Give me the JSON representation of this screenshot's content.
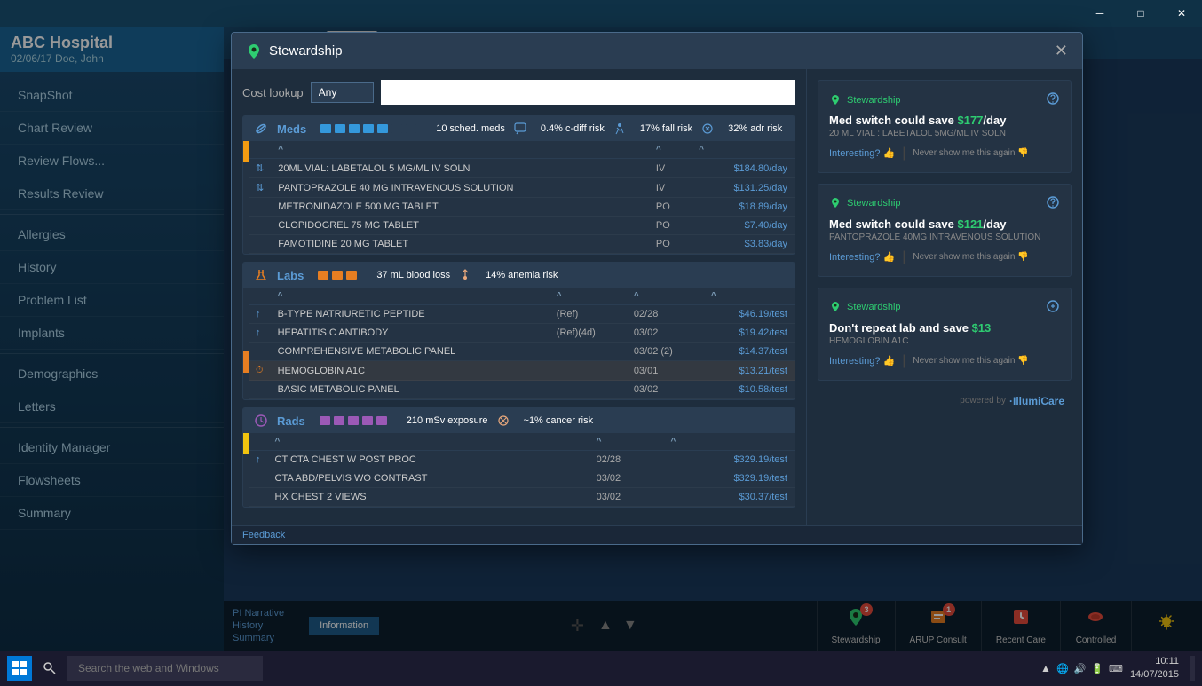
{
  "window": {
    "title": "Stewardship",
    "close_label": "✕",
    "minimize_label": "─",
    "maximize_label": "□"
  },
  "top_bar": {},
  "sidebar": {
    "hospital": "ABC Hospital",
    "date_patient": "02/06/17  Doe, John",
    "items": [
      {
        "label": "SnapShot",
        "active": false
      },
      {
        "label": "Chart Review",
        "active": false
      },
      {
        "label": "Review Flows...",
        "active": false
      },
      {
        "label": "Results Review",
        "active": false
      },
      {
        "label": "Allergies",
        "active": false
      },
      {
        "label": "History",
        "active": false
      },
      {
        "label": "Problem List",
        "active": false
      },
      {
        "label": "Implants",
        "active": false
      },
      {
        "label": "Demographics",
        "active": false
      },
      {
        "label": "Letters",
        "active": false
      },
      {
        "label": "Identity Manager",
        "active": false
      },
      {
        "label": "Flowsheets",
        "active": false
      },
      {
        "label": "Summary",
        "active": false
      }
    ]
  },
  "modal": {
    "title": "Stewardship",
    "cost_lookup_label": "Cost lookup",
    "cost_lookup_select": "Any",
    "cost_lookup_placeholder": "",
    "sections": {
      "meds": {
        "title": "Meds",
        "bar_count": 7,
        "stat1": "10 sched. meds",
        "stat2": "0.4% c-diff risk",
        "stat3": "17% fall risk",
        "stat4": "32% adr risk",
        "rows": [
          {
            "icon": "↑",
            "name": "20ML VIAL: LABETALOL 5 MG/ML IV SOLN",
            "route": "IV",
            "price": "$184.80/day",
            "indicator": "yellow"
          },
          {
            "icon": "↑",
            "name": "PANTOPRAZOLE 40 MG INTRAVENOUS SOLUTION",
            "route": "IV",
            "price": "$131.25/day",
            "indicator": "none"
          },
          {
            "icon": "",
            "name": "METRONIDAZOLE 500 MG TABLET",
            "route": "PO",
            "price": "$18.89/day",
            "indicator": "none"
          },
          {
            "icon": "",
            "name": "CLOPIDOGREL 75 MG TABLET",
            "route": "PO",
            "price": "$7.40/day",
            "indicator": "none"
          },
          {
            "icon": "",
            "name": "FAMOTIDINE 20 MG TABLET",
            "route": "PO",
            "price": "$3.83/day",
            "indicator": "none"
          }
        ]
      },
      "labs": {
        "title": "Labs",
        "bar_count": 3,
        "stat1": "37 mL blood loss",
        "stat2": "14% anemia risk",
        "rows": [
          {
            "icon": "↑",
            "name": "B-TYPE NATRIURETIC PEPTIDE",
            "ref": "(Ref)",
            "date": "02/28",
            "price": "$46.19/test",
            "indicator": "none"
          },
          {
            "icon": "↑",
            "name": "HEPATITIS C ANTIBODY",
            "ref": "(Ref)(4d)",
            "date": "03/02",
            "price": "$19.42/test",
            "indicator": "none"
          },
          {
            "icon": "",
            "name": "COMPREHENSIVE METABOLIC PANEL",
            "ref": "",
            "date": "03/02 (2)",
            "price": "$14.37/test",
            "indicator": "none"
          },
          {
            "icon": "⏱",
            "name": "HEMOGLOBIN A1C",
            "ref": "",
            "date": "03/01",
            "price": "$13.21/test",
            "indicator": "orange"
          },
          {
            "icon": "",
            "name": "BASIC METABOLIC PANEL",
            "ref": "",
            "date": "03/02",
            "price": "$10.58/test",
            "indicator": "none"
          }
        ]
      },
      "rads": {
        "title": "Rads",
        "bar_count": 5,
        "stat1": "210 mSv exposure",
        "stat2": "~1% cancer risk",
        "rows": [
          {
            "icon": "↑",
            "name": "CT CTA CHEST W POST PROC",
            "date": "02/28",
            "price": "$329.19/test",
            "indicator": "yellow"
          },
          {
            "icon": "",
            "name": "CTA ABD/PELVIS WO CONTRAST",
            "date": "03/02",
            "price": "$329.19/test",
            "indicator": "none"
          },
          {
            "icon": "",
            "name": "HX CHEST 2 VIEWS",
            "date": "03/02",
            "price": "$30.37/test",
            "indicator": "none"
          }
        ]
      }
    },
    "suggestions": [
      {
        "brand": "Stewardship",
        "title_prefix": "Med switch could save ",
        "amount": "$177",
        "title_suffix": "/day",
        "detail": "20 ML VIAL : LABETALOL 5MG/ML IV SOLN",
        "interesting_label": "Interesting?",
        "never_label": "Never show me this again"
      },
      {
        "brand": "Stewardship",
        "title_prefix": "Med switch could save ",
        "amount": "$121",
        "title_suffix": "/day",
        "detail": "PANTOPRAZOLE 40MG INTRAVENOUS SOLUTION",
        "interesting_label": "Interesting?",
        "never_label": "Never show me this again"
      },
      {
        "brand": "Stewardship",
        "title_prefix": "Don't repeat lab and save ",
        "amount": "$13",
        "title_suffix": "",
        "detail": "HEMOGLOBIN A1C",
        "interesting_label": "Interesting?",
        "never_label": "Never show me this again"
      }
    ],
    "powered_by": "powered by",
    "powered_brand": "·IllumiCare"
  },
  "bottom_links": [
    {
      "label": "PI Narrative"
    },
    {
      "label": "History"
    },
    {
      "label": "Summary"
    }
  ],
  "info_tab": "Information",
  "toolbar_buttons": [
    {
      "id": "stewardship",
      "label": "Stewardship",
      "badge": "3",
      "icon": "🌿"
    },
    {
      "id": "arup-consult",
      "label": "ARUP Consult",
      "badge": "1",
      "icon": "🧪"
    },
    {
      "id": "recent-care",
      "label": "Recent Care",
      "badge": "",
      "icon": "➕"
    },
    {
      "id": "controlled",
      "label": "Controlled",
      "badge": "",
      "icon": "💊"
    },
    {
      "id": "light",
      "label": "",
      "badge": "",
      "icon": "💡"
    }
  ],
  "feedback_label": "Feedback",
  "taskbar": {
    "search_placeholder": "Search the web and Windows",
    "time": "10:11",
    "date": "14/07/2015"
  }
}
